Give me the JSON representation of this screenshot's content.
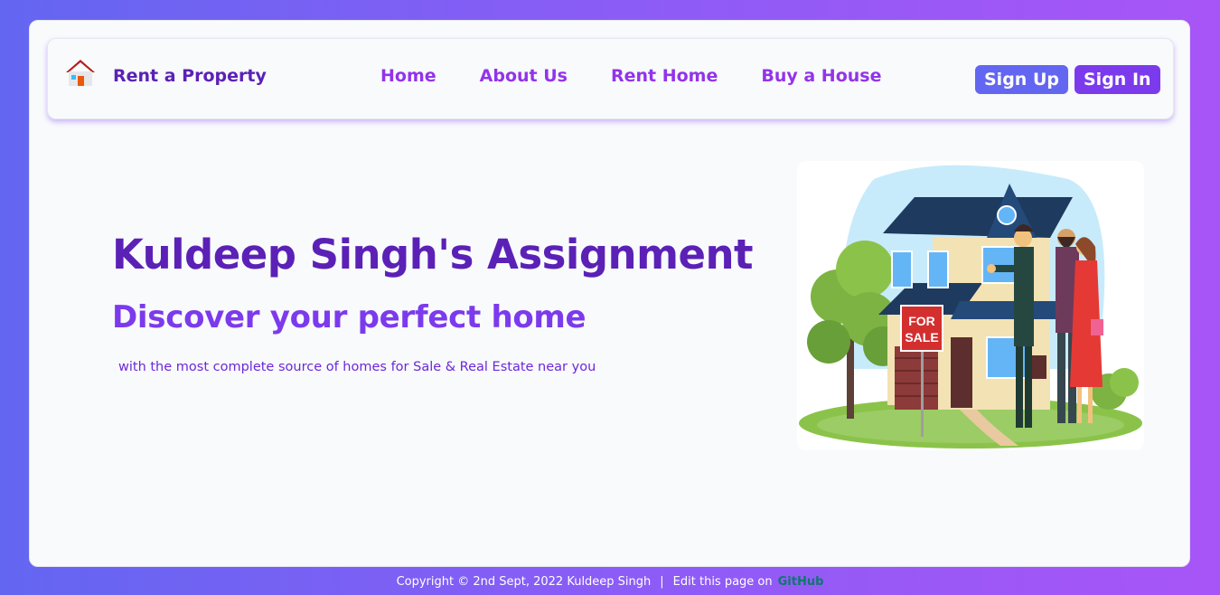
{
  "navbar": {
    "brand_name": "Rent a Property",
    "brand_icon": "house-icon",
    "links": [
      "Home",
      "About Us",
      "Rent Home",
      "Buy a House"
    ],
    "signup_label": "Sign Up",
    "signin_label": "Sign In"
  },
  "hero": {
    "title": "Kuldeep Singh's Assignment",
    "subtitle": "Discover your perfect home",
    "description": "with the most complete source of homes for Sale & Real Estate near you",
    "sign_line1": "FOR",
    "sign_line2": "SALE"
  },
  "footer": {
    "copyright": "Copyright © 2nd Sept, 2022 Kuldeep Singh",
    "separator": "|",
    "edit_text": "Edit this page on",
    "link_text": "GitHub"
  },
  "colors": {
    "brand": "#5b21b6",
    "accent": "#9333ea",
    "signup": "#6366f1",
    "signin": "#7c3aed"
  }
}
